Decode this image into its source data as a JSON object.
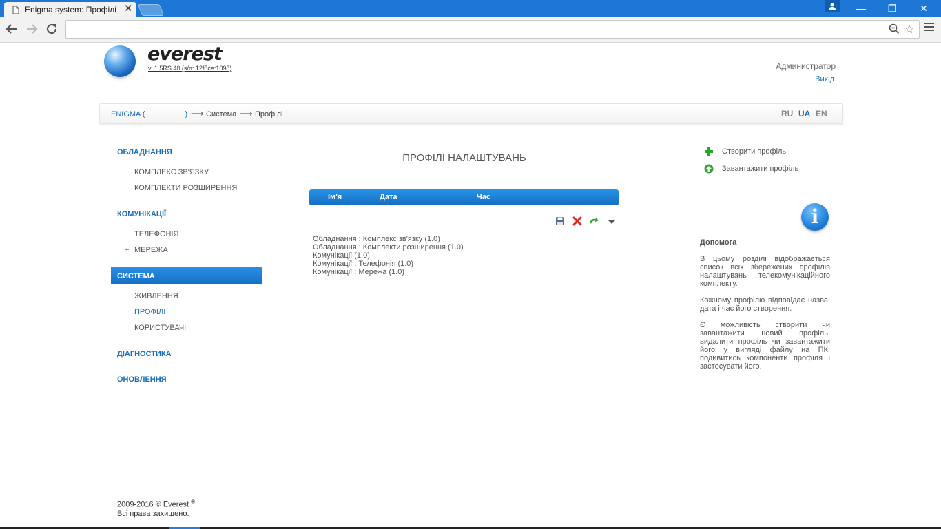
{
  "browser": {
    "tab_title": "Enigma system: Профілі",
    "tab_close": "✕",
    "address": "",
    "win_min": "—",
    "win_restore": "❐",
    "win_close": "✕"
  },
  "header": {
    "logo_text": "everest",
    "version_prefix": "v. 1.5RS ",
    "version_build": "48",
    "version_serial": " (s/n: 12f8ce:1098)",
    "user_name": "Администратор",
    "logout": "Вихід"
  },
  "breadcrumb": {
    "root": "ENIGMA (",
    "root_close": ")",
    "arrow": "⟶",
    "items": [
      "Система",
      "Профілі"
    ]
  },
  "languages": [
    "RU",
    "UA",
    "EN"
  ],
  "active_language": "UA",
  "sidebar": {
    "sections": [
      {
        "label": "ОБЛАДНАННЯ",
        "items": [
          "КОМПЛЕКС ЗВ'ЯЗКУ",
          "КОМПЛЕКТИ РОЗШИРЕННЯ"
        ]
      },
      {
        "label": "КОМУНІКАЦІЇ",
        "items": [
          "ТЕЛЕФОНІЯ",
          "МЕРЕЖА"
        ],
        "expand_marker": "+"
      },
      {
        "label": "СИСТЕМА",
        "items": [
          "ЖИВЛЕННЯ",
          "ПРОФІЛІ",
          "КОРИСТУВАЧІ"
        ],
        "active": true,
        "active_item": "ПРОФІЛІ"
      },
      {
        "label": "ДІАГНОСТИКА",
        "items": []
      },
      {
        "label": "ОНОВЛЕННЯ",
        "items": []
      }
    ]
  },
  "main": {
    "title": "ПРОФІЛІ НАЛАШТУВАНЬ",
    "columns": [
      "Ім'я",
      "Дата",
      "Час"
    ],
    "row": {
      "name_placeholder": "-",
      "actions": [
        "save-icon",
        "delete-icon",
        "apply-icon",
        "expand-icon"
      ],
      "components": [
        "Обладнання : Комплекс зв'язку (1.0)",
        "Обладнання : Комплекти розширення (1.0)",
        "Комунікації (1.0)",
        "Комунікації : Телефонія (1.0)",
        "Комунікації : Мережа (1.0)"
      ]
    }
  },
  "actions_panel": {
    "create": "Створити профіль",
    "upload": "Завантажити профіль"
  },
  "help": {
    "icon_text": "i",
    "title": "Допомога",
    "paragraphs": [
      "В цьому розділі відображається список всіх збережених профілів налаштувань телекомунікаційного комплекту.",
      "Кожному профілю відповідає назва, дата і час його створення.",
      "Є можливість створити чи завантажити новий профіль, видалити профіль чи завантажити його у вигляді файлу на ПК, подивитись компоненти профіля і застосувати його."
    ]
  },
  "footer": {
    "copyright": "2009-2016 © Everest",
    "registered": "®",
    "rights": "Всі права захищено."
  },
  "colors": {
    "accent": "#1a6fb8",
    "titlebar": "#1c78d4",
    "header_blue": "#1f80d6"
  }
}
